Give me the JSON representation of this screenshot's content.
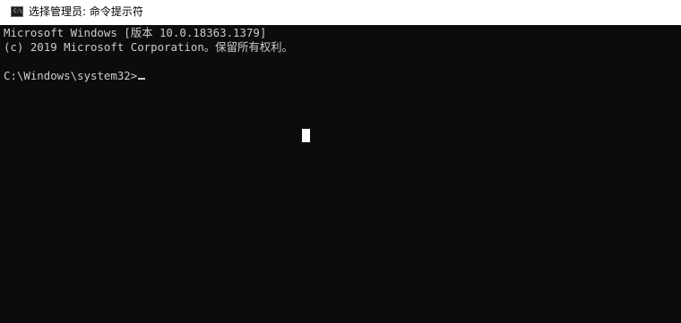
{
  "window": {
    "title": "选择管理员: 命令提示符",
    "icon": "cmd-icon",
    "icon_glyph": "C:\\"
  },
  "console": {
    "lines": [
      "Microsoft Windows [版本 10.0.18363.1379]",
      "(c) 2019 Microsoft Corporation。保留所有权利。",
      "",
      "C:\\Windows\\system32>"
    ],
    "background_color": "#0c0c0c",
    "text_color": "#cccccc"
  }
}
